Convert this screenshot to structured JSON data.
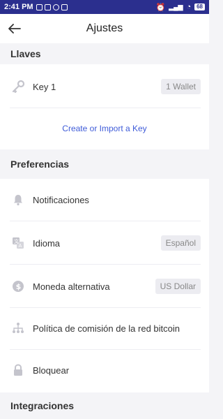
{
  "status": {
    "time": "2:41 PM",
    "battery": "68"
  },
  "header": {
    "title": "Ajustes"
  },
  "sections": {
    "llaves": {
      "title": "Llaves"
    },
    "preferencias": {
      "title": "Preferencias"
    },
    "integraciones": {
      "title": "Integraciones"
    }
  },
  "keys": {
    "key1": {
      "label": "Key 1",
      "badge": "1 Wallet"
    },
    "create_link": "Create or Import a Key"
  },
  "prefs": {
    "notifications": {
      "label": "Notificaciones"
    },
    "language": {
      "label": "Idioma",
      "value": "Español"
    },
    "currency": {
      "label": "Moneda alternativa",
      "value": "US Dollar"
    },
    "fee_policy": {
      "label": "Política de comisión de la red bitcoin"
    },
    "lock": {
      "label": "Bloquear"
    }
  },
  "colors": {
    "statusbar": "#2b2f8e",
    "link": "#3e5bd8",
    "icon": "#c4c4cc"
  }
}
